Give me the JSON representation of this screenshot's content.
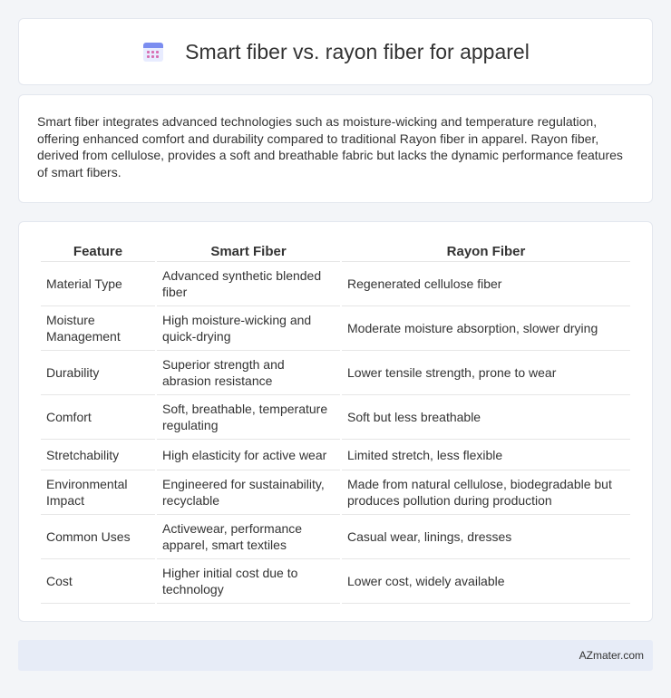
{
  "header": {
    "title": "Smart fiber vs. rayon fiber for apparel",
    "icon": "calendar-icon"
  },
  "intro": {
    "text": "Smart fiber integrates advanced technologies such as moisture-wicking and temperature regulation, offering enhanced comfort and durability compared to traditional Rayon fiber in apparel. Rayon fiber, derived from cellulose, provides a soft and breathable fabric but lacks the dynamic performance features of smart fibers."
  },
  "table": {
    "headers": [
      "Feature",
      "Smart Fiber",
      "Rayon Fiber"
    ],
    "rows": [
      [
        "Material Type",
        "Advanced synthetic blended fiber",
        "Regenerated cellulose fiber"
      ],
      [
        "Moisture Management",
        "High moisture-wicking and quick-drying",
        "Moderate moisture absorption, slower drying"
      ],
      [
        "Durability",
        "Superior strength and abrasion resistance",
        "Lower tensile strength, prone to wear"
      ],
      [
        "Comfort",
        "Soft, breathable, temperature regulating",
        "Soft but less breathable"
      ],
      [
        "Stretchability",
        "High elasticity for active wear",
        "Limited stretch, less flexible"
      ],
      [
        "Environmental Impact",
        "Engineered for sustainability, recyclable",
        "Made from natural cellulose, biodegradable but produces pollution during production"
      ],
      [
        "Common Uses",
        "Activewear, performance apparel, smart textiles",
        "Casual wear, linings, dresses"
      ],
      [
        "Cost",
        "Higher initial cost due to technology",
        "Lower cost, widely available"
      ]
    ]
  },
  "footer": {
    "brand": "AZmater.com"
  }
}
